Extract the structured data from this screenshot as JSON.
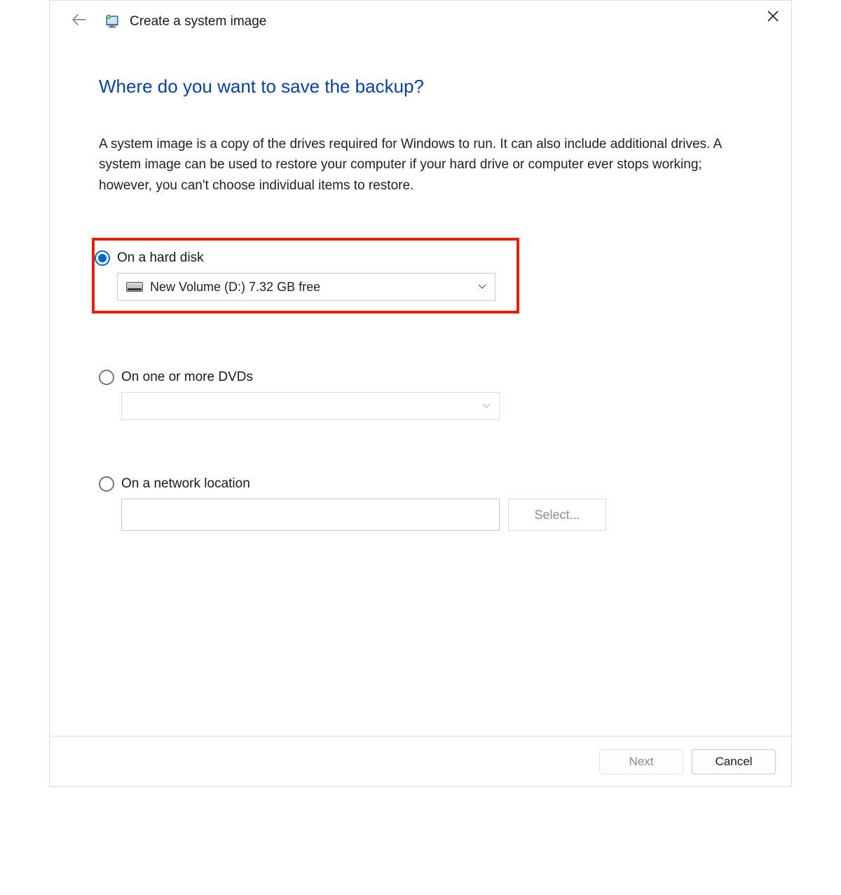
{
  "header": {
    "title": "Create a system image"
  },
  "main": {
    "heading": "Where do you want to save the backup?",
    "description": "A system image is a copy of the drives required for Windows to run. It can also include additional drives. A system image can be used to restore your computer if your hard drive or computer ever stops working; however, you can't choose individual items to restore."
  },
  "options": {
    "hard_disk": {
      "label": "On a hard disk",
      "selected_value": "New Volume (D:)  7.32 GB free"
    },
    "dvd": {
      "label": "On one or more DVDs",
      "selected_value": ""
    },
    "network": {
      "label": "On a network location",
      "path_value": "",
      "select_button": "Select..."
    }
  },
  "footer": {
    "next": "Next",
    "cancel": "Cancel"
  }
}
